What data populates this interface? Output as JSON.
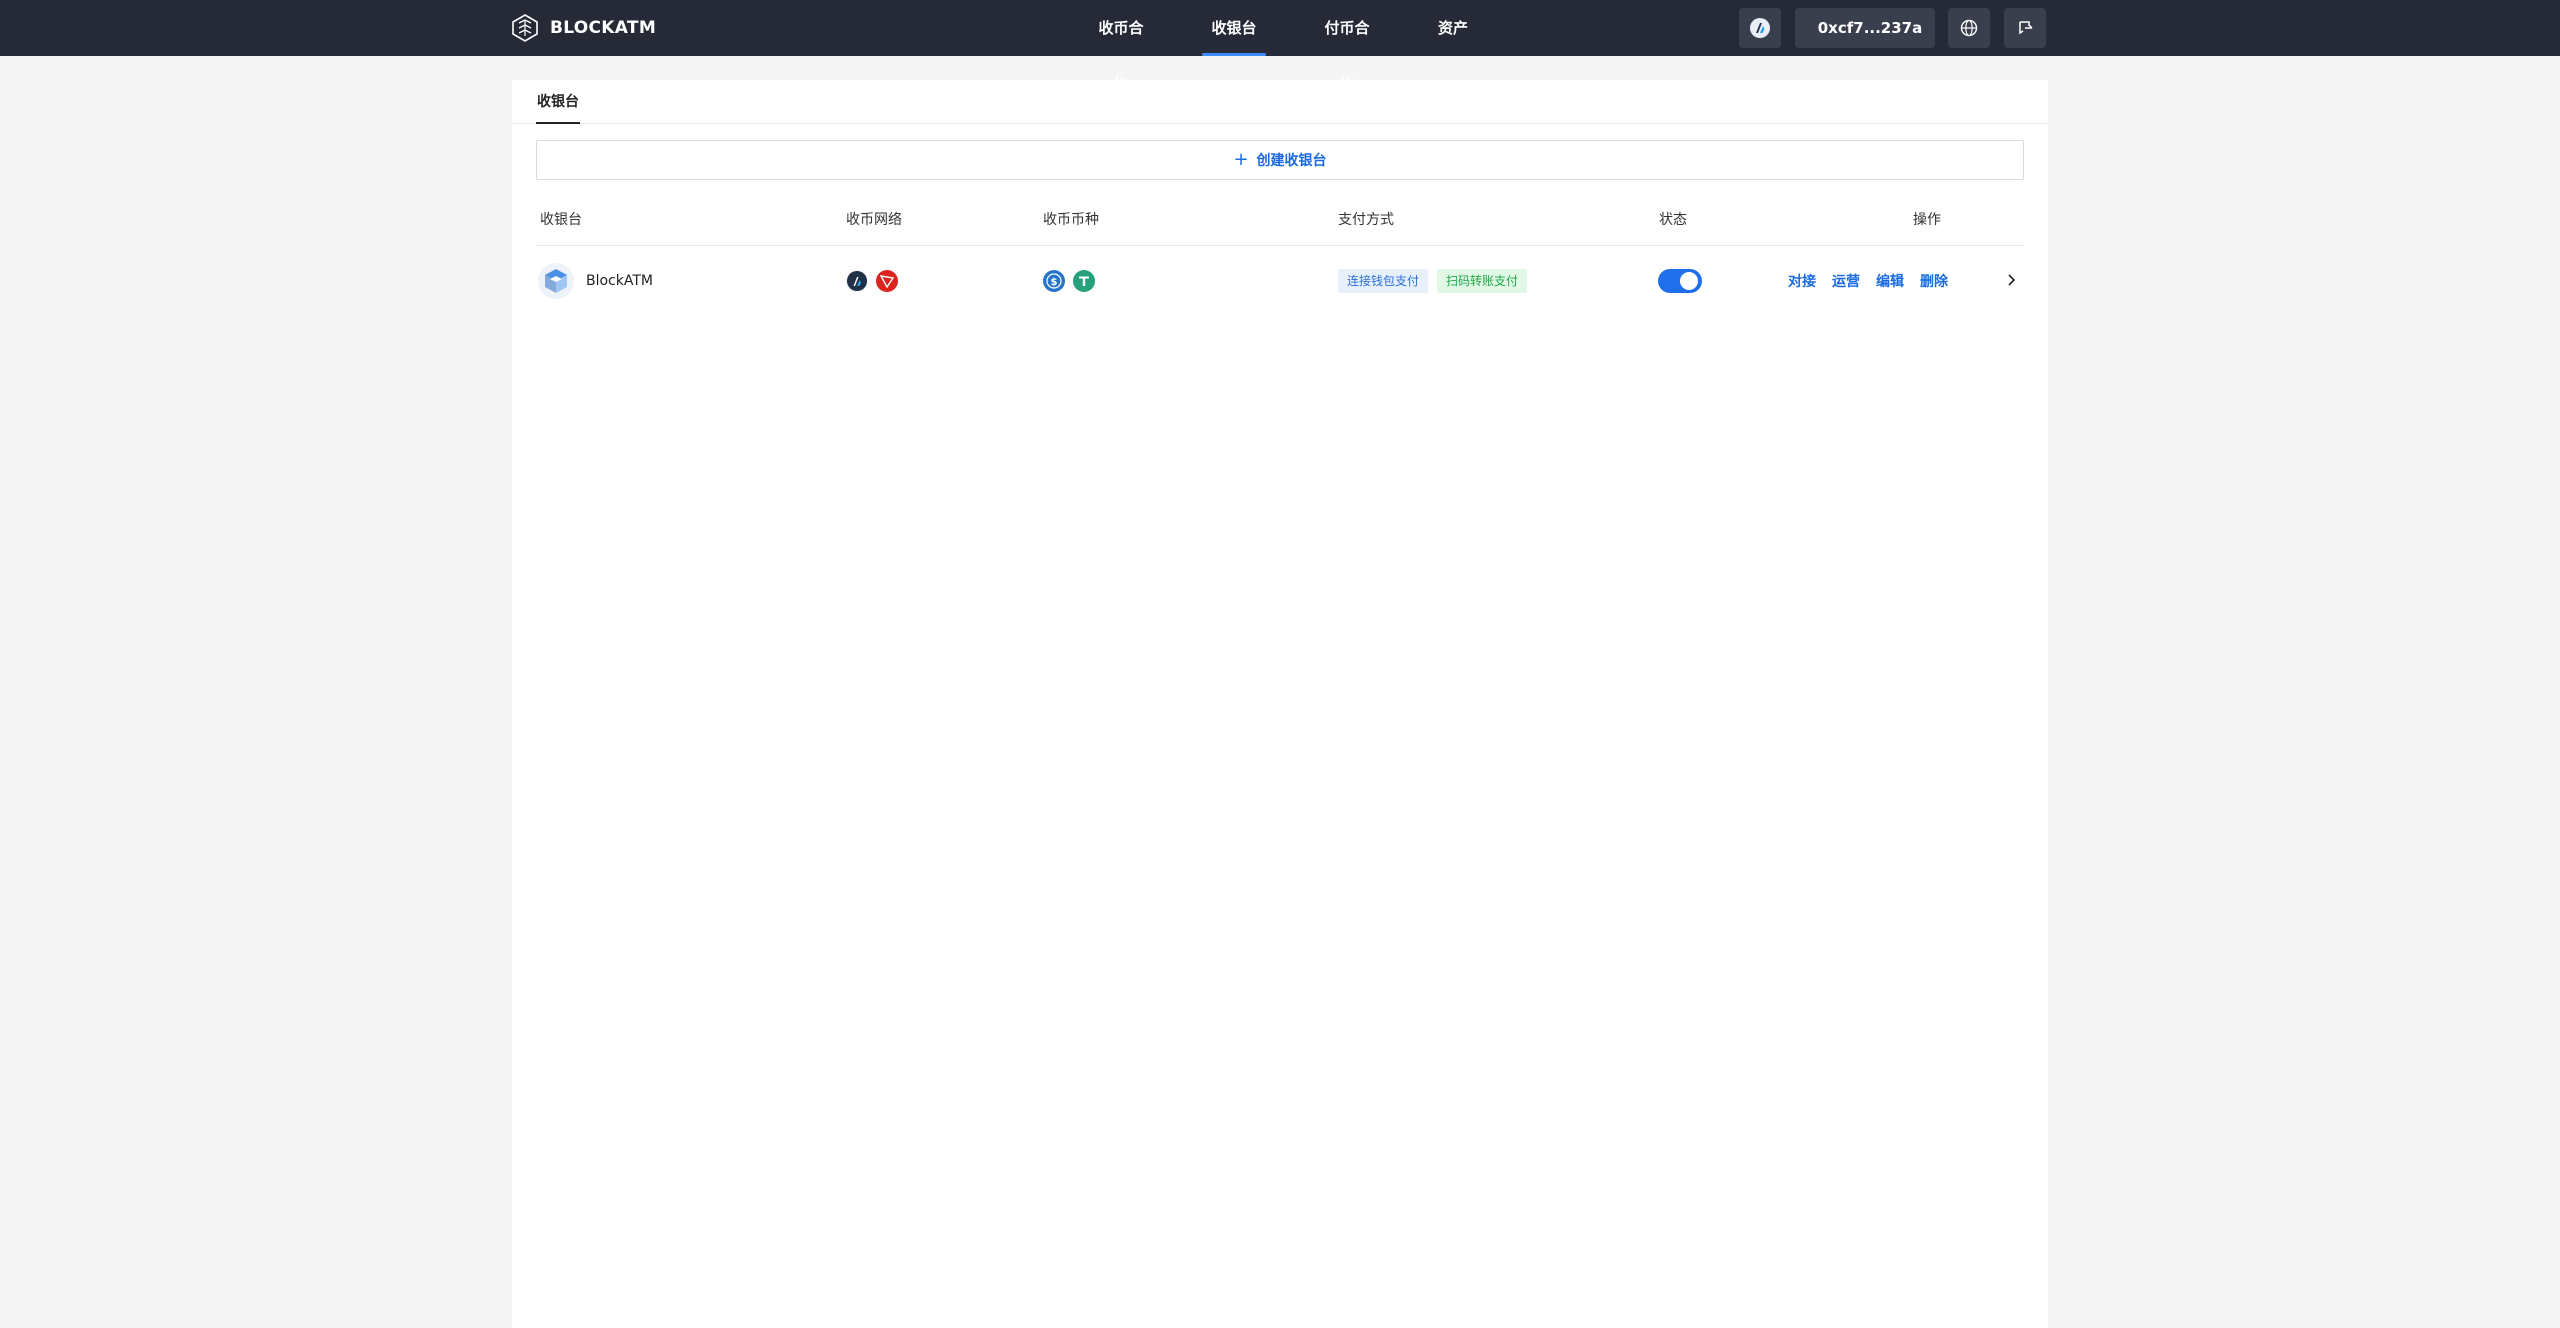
{
  "nav": {
    "brand": "BLOCKATM",
    "links": [
      {
        "label": "收币合约",
        "active": false
      },
      {
        "label": "收银台",
        "active": true
      },
      {
        "label": "付币合约",
        "active": false
      },
      {
        "label": "资产",
        "active": false
      }
    ],
    "wallet_address": "0xcf7...237a",
    "colors": {
      "bar": "#262a37",
      "active_underline": "#3d8bff"
    }
  },
  "page": {
    "tab_label": "收银台",
    "create_button": "创建收银台",
    "columns": [
      "收银台",
      "收币网络",
      "收币币种",
      "支付方式",
      "状态",
      "操作"
    ],
    "rows": [
      {
        "name": "BlockATM",
        "networks": [
          "arbitrum-icon",
          "tron-icon"
        ],
        "coins": [
          "usdc-icon",
          "usdt-icon"
        ],
        "payment_methods": [
          "连接钱包支付",
          "扫码转账支付"
        ],
        "status_on": true,
        "actions": [
          "对接",
          "运营",
          "编辑",
          "删除"
        ]
      }
    ]
  }
}
